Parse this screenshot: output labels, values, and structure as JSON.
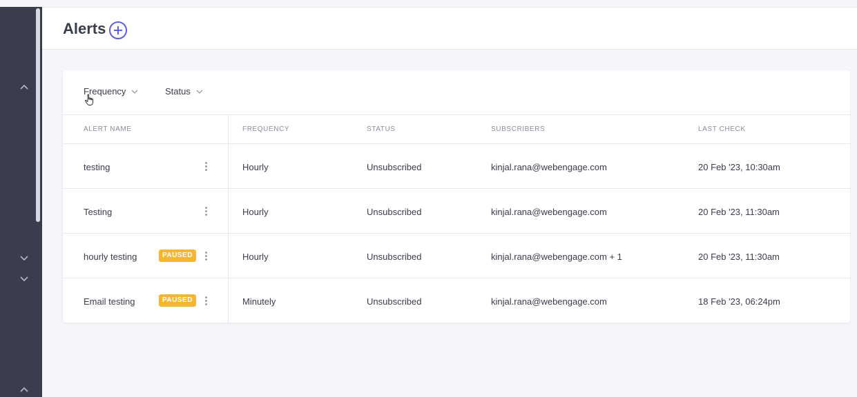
{
  "header": {
    "title": "Alerts"
  },
  "filters": [
    {
      "label": "Frequency"
    },
    {
      "label": "Status"
    }
  ],
  "table": {
    "columns": [
      "ALERT NAME",
      "FREQUENCY",
      "STATUS",
      "SUBSCRIBERS",
      "LAST CHECK"
    ],
    "rows": [
      {
        "name": "testing",
        "badge": "",
        "frequency": "Hourly",
        "status": "Unsubscribed",
        "subscribers": "kinjal.rana@webengage.com",
        "last_check": "20 Feb '23, 10:30am"
      },
      {
        "name": "Testing",
        "badge": "",
        "frequency": "Hourly",
        "status": "Unsubscribed",
        "subscribers": "kinjal.rana@webengage.com",
        "last_check": "20 Feb '23, 11:30am"
      },
      {
        "name": "hourly testing",
        "badge": "PAUSED",
        "frequency": "Hourly",
        "status": "Unsubscribed",
        "subscribers": "kinjal.rana@webengage.com + 1",
        "last_check": "20 Feb '23, 11:30am"
      },
      {
        "name": "Email testing",
        "badge": "PAUSED",
        "frequency": "Minutely",
        "status": "Unsubscribed",
        "subscribers": "kinjal.rana@webengage.com",
        "last_check": "18 Feb '23, 06:24pm"
      }
    ]
  },
  "icons": {
    "add": "plus-circle-icon",
    "caret": "chevron-down-icon",
    "row_menu": "kebab-menu-icon",
    "sidebar": [
      "chevron-up-icon",
      "chevron-down-icon",
      "chevron-down-icon",
      "chevron-up-icon"
    ]
  },
  "colors": {
    "accent": "#5c5fd6",
    "paused_badge": "#f5b731",
    "sidebar": "#3a3d4d",
    "background": "#f5f6fa"
  }
}
